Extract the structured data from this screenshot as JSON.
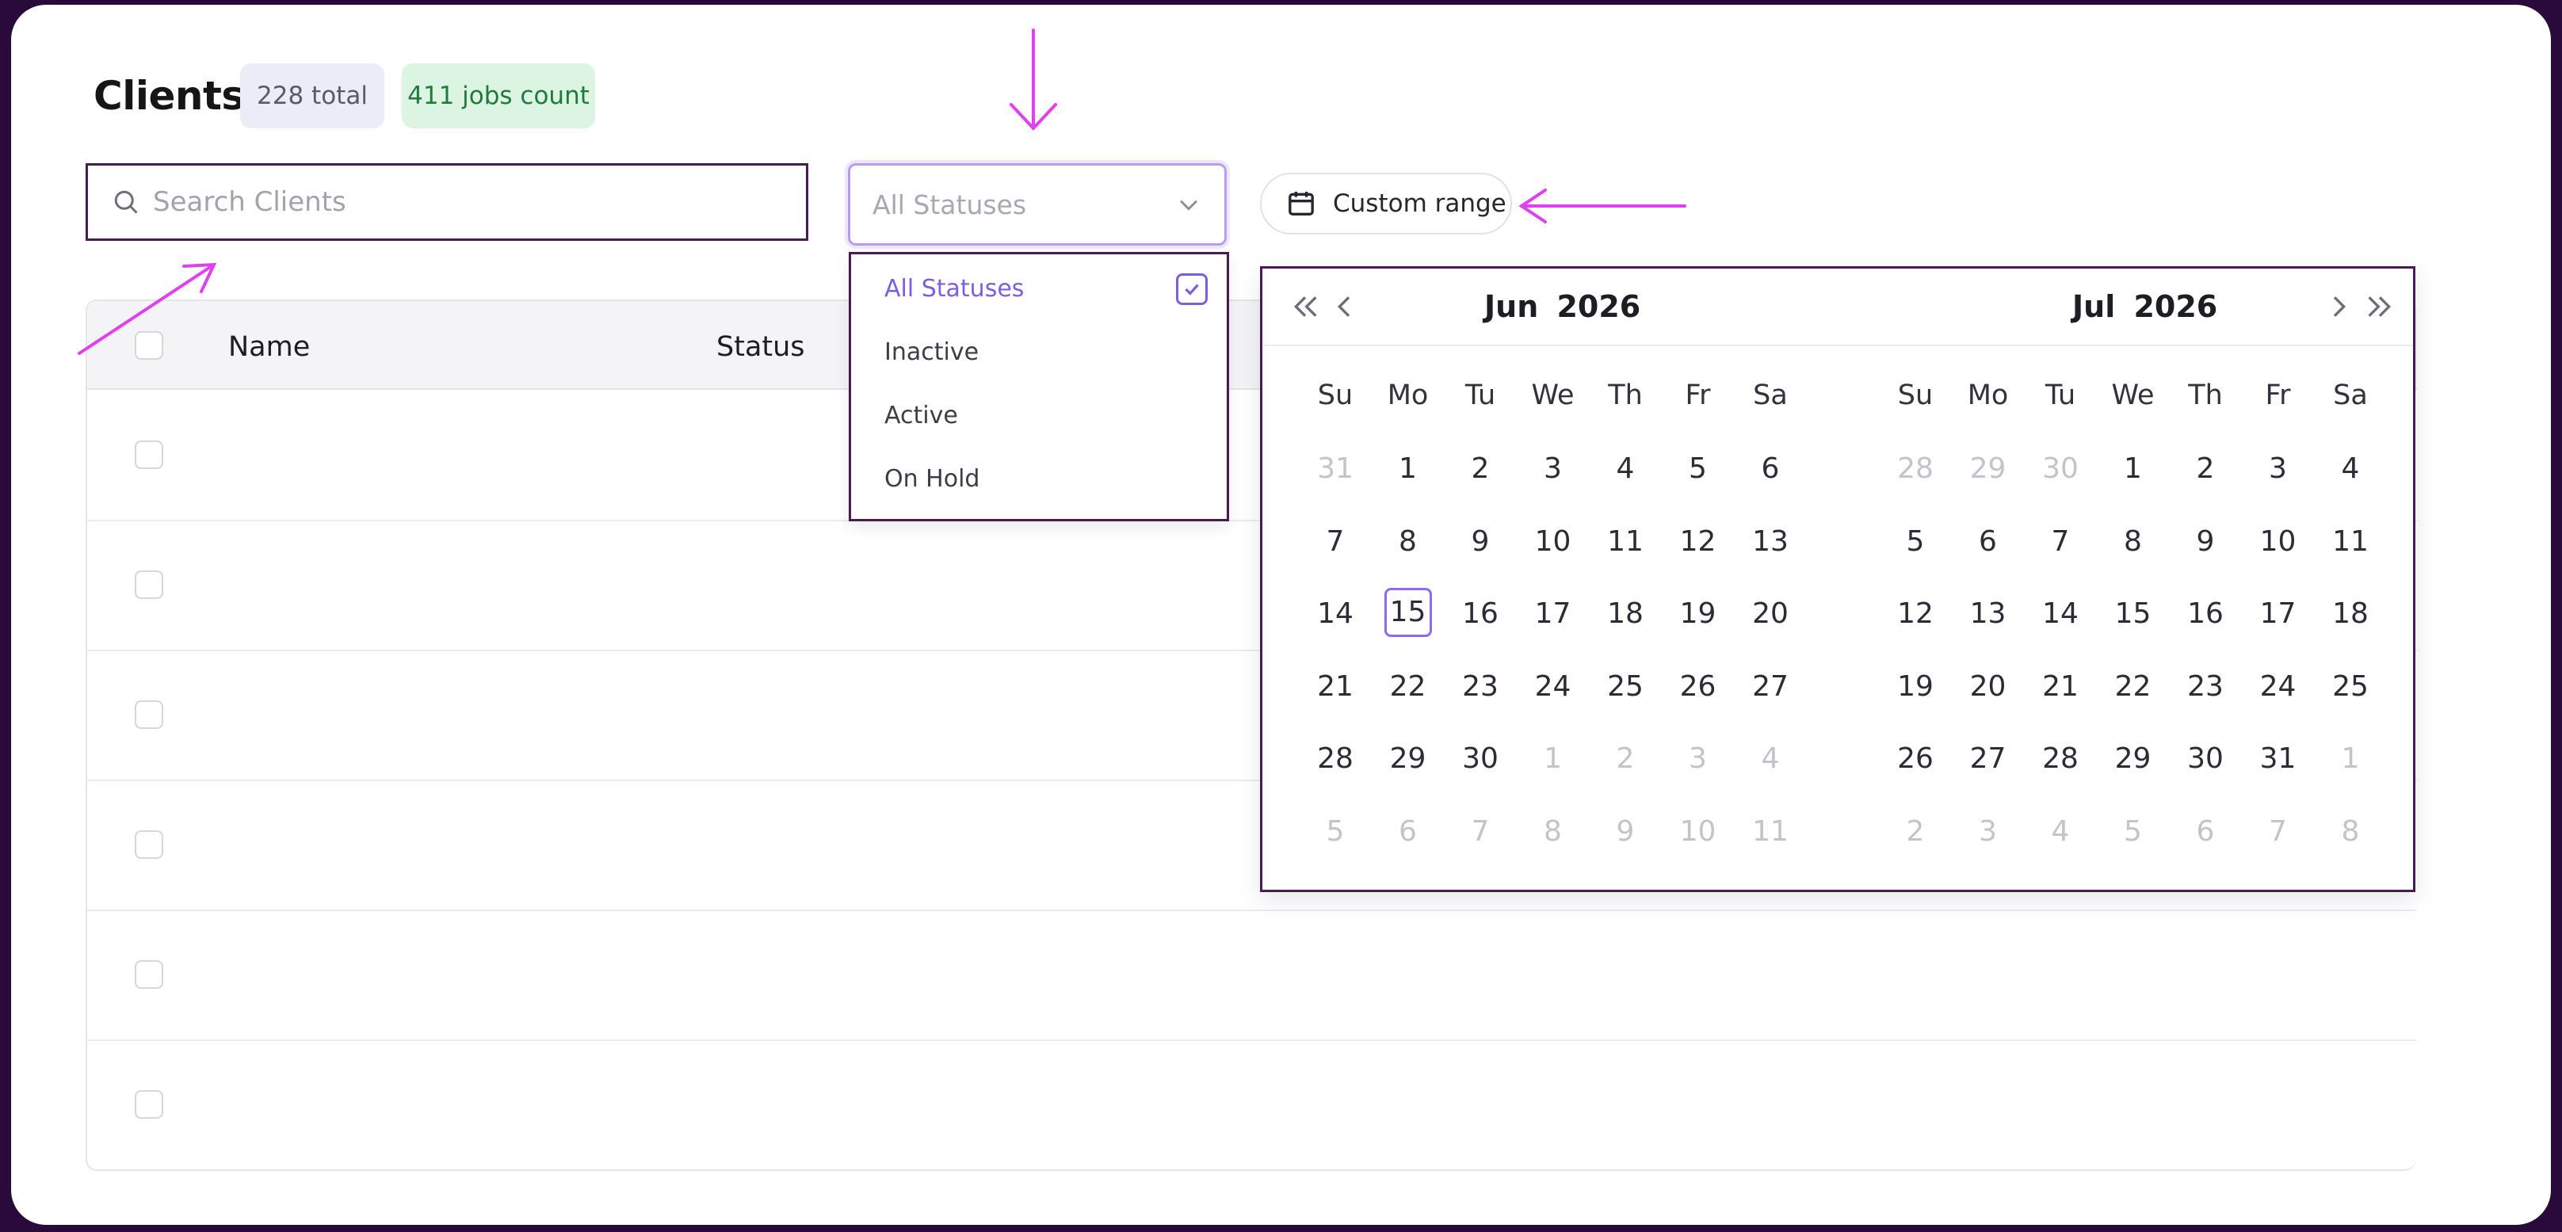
{
  "header": {
    "title": "Clients",
    "total_badge": "228 total",
    "jobs_badge": "411 jobs count"
  },
  "search": {
    "placeholder": "Search Clients",
    "value": ""
  },
  "status_filter": {
    "selected": "All Statuses",
    "options": [
      "All Statuses",
      "Inactive",
      "Active",
      "On Hold"
    ]
  },
  "range_button": {
    "label": "Custom range"
  },
  "table": {
    "columns": [
      "Name",
      "Status"
    ],
    "rows": 6
  },
  "calendar": {
    "left": {
      "month": "Jun",
      "year": "2026",
      "weekdays": [
        "Su",
        "Mo",
        "Tu",
        "We",
        "Th",
        "Fr",
        "Sa"
      ],
      "weeks": [
        [
          "31",
          "1",
          "2",
          "3",
          "4",
          "5",
          "6"
        ],
        [
          "7",
          "8",
          "9",
          "10",
          "11",
          "12",
          "13"
        ],
        [
          "14",
          "15",
          "16",
          "17",
          "18",
          "19",
          "20"
        ],
        [
          "21",
          "22",
          "23",
          "24",
          "25",
          "26",
          "27"
        ],
        [
          "28",
          "29",
          "30",
          "1",
          "2",
          "3",
          "4"
        ],
        [
          "5",
          "6",
          "7",
          "8",
          "9",
          "10",
          "11"
        ]
      ],
      "muted": [
        [
          0,
          0
        ],
        [
          4,
          3
        ],
        [
          4,
          4
        ],
        [
          4,
          5
        ],
        [
          4,
          6
        ],
        [
          5,
          0
        ],
        [
          5,
          1
        ],
        [
          5,
          2
        ],
        [
          5,
          3
        ],
        [
          5,
          4
        ],
        [
          5,
          5
        ],
        [
          5,
          6
        ]
      ],
      "today": [
        2,
        1
      ]
    },
    "right": {
      "month": "Jul",
      "year": "2026",
      "weekdays": [
        "Su",
        "Mo",
        "Tu",
        "We",
        "Th",
        "Fr",
        "Sa"
      ],
      "weeks": [
        [
          "28",
          "29",
          "30",
          "1",
          "2",
          "3",
          "4"
        ],
        [
          "5",
          "6",
          "7",
          "8",
          "9",
          "10",
          "11"
        ],
        [
          "12",
          "13",
          "14",
          "15",
          "16",
          "17",
          "18"
        ],
        [
          "19",
          "20",
          "21",
          "22",
          "23",
          "24",
          "25"
        ],
        [
          "26",
          "27",
          "28",
          "29",
          "30",
          "31",
          "1"
        ],
        [
          "2",
          "3",
          "4",
          "5",
          "6",
          "7",
          "8"
        ]
      ],
      "muted": [
        [
          0,
          0
        ],
        [
          0,
          1
        ],
        [
          0,
          2
        ],
        [
          4,
          6
        ],
        [
          5,
          0
        ],
        [
          5,
          1
        ],
        [
          5,
          2
        ],
        [
          5,
          3
        ],
        [
          5,
          4
        ],
        [
          5,
          5
        ],
        [
          5,
          6
        ]
      ]
    }
  },
  "colors": {
    "accent": "#7b5fe0",
    "annotation": "#e040f0",
    "frame": "#2a0a3a"
  }
}
